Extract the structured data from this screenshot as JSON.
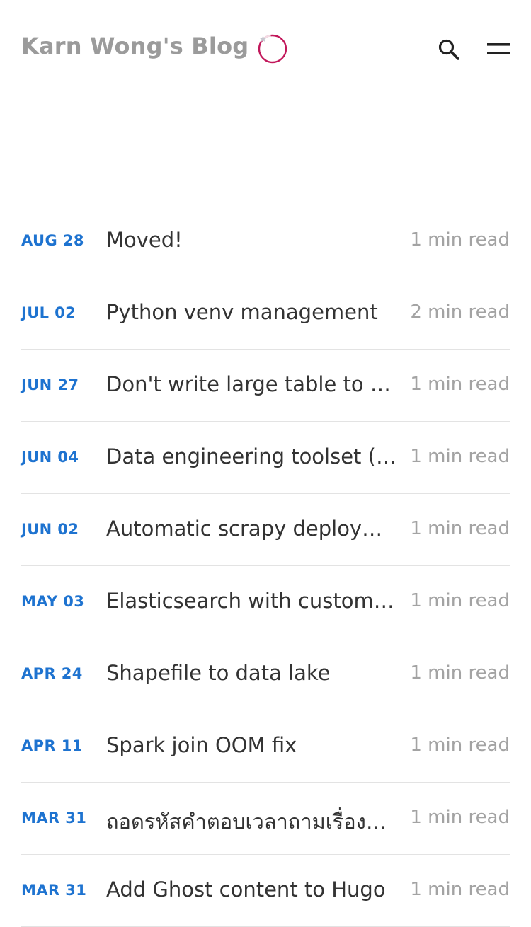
{
  "header": {
    "site_title": "Karn Wong's Blog",
    "logo_icon": "spinner-ring-icon",
    "search_icon": "search-icon",
    "menu_icon": "menu-icon"
  },
  "colors": {
    "date_accent": "#1e73d0",
    "title_gray": "#9b9b9b",
    "ring_crimson": "#c2185b",
    "divider": "#e3e3e3"
  },
  "posts": [
    {
      "date": "AUG 28",
      "title": "Moved!",
      "read_time": "1 min read"
    },
    {
      "date": "JUL 02",
      "title": "Python venv management",
      "read_time": "2 min read"
    },
    {
      "date": "JUN 27",
      "title": "Don't write large table to …",
      "read_time": "1 min read"
    },
    {
      "date": "JUN 04",
      "title": "Data engineering toolset (…",
      "read_time": "1 min read"
    },
    {
      "date": "JUN 02",
      "title": "Automatic scrapy deploy…",
      "read_time": "1 min read"
    },
    {
      "date": "MAY 03",
      "title": "Elasticsearch with custom…",
      "read_time": "1 min read"
    },
    {
      "date": "APR 24",
      "title": "Shapefile to data lake",
      "read_time": "1 min read"
    },
    {
      "date": "APR 11",
      "title": "Spark join OOM fix",
      "read_time": "1 min read"
    },
    {
      "date": "MAR 31",
      "title": "ถอดรหัสคำตอบเวลาถามเรื่อง…",
      "read_time": "1 min read"
    },
    {
      "date": "MAR 31",
      "title": "Add Ghost content to Hugo",
      "read_time": "1 min read"
    }
  ]
}
